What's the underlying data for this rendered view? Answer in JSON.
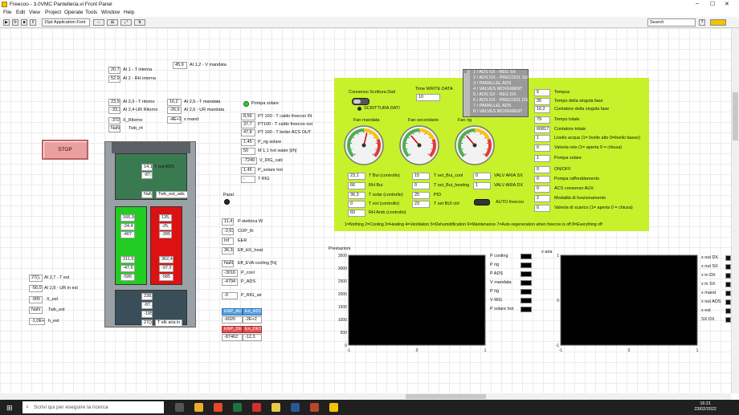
{
  "window": {
    "title": "Freecoo - 3.0VMC Pantelleria.vi Front Panel"
  },
  "menu": [
    "File",
    "Edit",
    "View",
    "Project",
    "Operate",
    "Tools",
    "Window",
    "Help"
  ],
  "toolbar": {
    "font": "15pt Application Font",
    "search_placeholder": "Search"
  },
  "stop_label": "STOP",
  "left_top": [
    {
      "value": "20,7",
      "label": "AI 1 - T interna"
    },
    {
      "value": "52,9",
      "label": "AI 2 - RH interna"
    },
    {
      "value": "45,9",
      "label": "AI 1,2 - V mandata"
    }
  ],
  "left_mid": [
    {
      "value": "23,9",
      "label": "AI 2,3 - T ritorno"
    },
    {
      "value": "-33,3",
      "label": "AI 2,4-UR Ritorno"
    },
    {
      "value": "-372",
      "label": "X_Ritorno"
    },
    {
      "value": "NaN",
      "label": "Twb_rit"
    }
  ],
  "mandata_group": [
    {
      "value": "16,2",
      "label": "AI 2,5 - T mandata"
    },
    {
      "value": "-26,6",
      "label": "AI 2,6 - UR mandata"
    },
    {
      "value": "-4E+2",
      "label": "x mand"
    }
  ],
  "pompa_solare": "Pompa solare",
  "sensors": [
    {
      "value": "8,56",
      "label": "PT 100 - T caldo freecoo IN"
    },
    {
      "value": "37,7",
      "label": "PT100 - T caldo freecoo out"
    },
    {
      "value": "47,8",
      "label": "PT 100 - T boiler ACS OUT"
    },
    {
      "value": "1,45",
      "label": "P_rig solare"
    },
    {
      "value": "50",
      "label": "M 1,1 hot water [l/h]"
    },
    {
      "value": "-7249",
      "label": "V_RIG_calc"
    },
    {
      "value": "1,45",
      "label": "P_solare hot"
    },
    {
      "value": "-",
      "label": "T RIG"
    }
  ],
  "machine_values": {
    "top": [
      "14,1",
      "-87,0"
    ],
    "top_label": "T out ADS",
    "twb_label": "Twb_out_ads",
    "green_upper": [
      "166,9",
      "-24,4",
      "-407"
    ],
    "red_upper": [
      "135,",
      "-25,",
      "-395"
    ],
    "green_lower": [
      "211,9",
      "-47,5",
      "-595"
    ],
    "red_lower": [
      "362,4",
      "-97,5",
      "-585"
    ],
    "bottom": [
      "238,",
      "-87,",
      "-195,"
    ],
    "bottom_label": "T elk aria in"
  },
  "left_bottom": [
    {
      "value": "27(),",
      "label": "AI 2,7 - T est"
    },
    {
      "value": "-56,0",
      "label": "AI 2,8 - UR in est"
    },
    {
      "value": "-905",
      "label": "X_est"
    },
    {
      "value": "NaN",
      "label": "Twb_est"
    },
    {
      "value": "-1,0E+",
      "label": "h_est"
    }
  ],
  "parallel_label": "Paral",
  "perf": [
    {
      "value": "11,4",
      "label": "P elettrica W"
    },
    {
      "value": "-2,63",
      "label": "COP_th"
    },
    {
      "value": "Inf",
      "label": "EER"
    },
    {
      "value": "36,3",
      "label": "Eff_HX_heat"
    },
    {
      "value": "NaN",
      "label": "Eff_EVA cooling [%]"
    },
    {
      "value": "-3016",
      "label": "P_cool"
    },
    {
      "value": "-4794",
      "label": "P_ADS"
    },
    {
      "value": "-0",
      "label": "P_RIG_air"
    }
  ],
  "adsdes": {
    "hdr1": "ENP_ADS",
    "hdr2": "En_ADS",
    "v1": "-6020",
    "v2": "-2E+2",
    "hdr3": "ENP_DES",
    "hdr4": "En_DES",
    "v3": "-87462",
    "v4": "-12,3"
  },
  "lime": {
    "consenso": "Consenso Scrittura Dati",
    "scrittura": "SCRITTURA DATI",
    "time_write_label": "Time WRITE DATA",
    "time_write_value": "10",
    "states": [
      "1 / ADS SX - REG SX",
      "2 / ADS DX - PRECOOL SX",
      "3 / PARALLEL ADS",
      "4 / VALVES MOVEMENT",
      "5 / ADS SX - REG DX",
      "6 / ADS DX - PRECOOL DX",
      "7 / PARALLEL ADS",
      "8 / VALVES MOVEMENT"
    ],
    "states_prefix": "0",
    "fans": [
      "Fan mandata",
      "Fan secondario",
      "Fan rig"
    ],
    "fan_values": [
      0.55,
      0.35,
      0.35
    ],
    "counters": [
      {
        "value": "5",
        "label": "Tempus"
      },
      {
        "value": "35",
        "label": "Tempo della singola fase"
      },
      {
        "value": "16,2",
        "label": "Contatore della singola fase"
      },
      {
        "value": "79",
        "label": "Tempo totale"
      },
      {
        "value": "60817",
        "label": "Contatore totale"
      },
      {
        "value": "1",
        "label": "Livello acqua (1= livello alto 0=livello basso)"
      },
      {
        "value": "0",
        "label": "Valvola rete (1= aperta 0 = chiusa)"
      },
      {
        "value": "1",
        "label": "Pompa solare"
      }
    ],
    "controls": [
      {
        "value": "23,1",
        "label": "T Bui (controllo)"
      },
      {
        "value": "66",
        "label": "RH Bui"
      },
      {
        "value": "36,3",
        "label": "T solar (controllo)"
      },
      {
        "value": "0",
        "label": "T ext (controllo)"
      },
      {
        "value": "60",
        "label": "RH Amb (controllo)"
      }
    ],
    "setpoints": [
      {
        "value": "15",
        "label": "T set_Bui_cool"
      },
      {
        "value": "0",
        "label": "T set_Bui_heating"
      },
      {
        "value": "25",
        "label": "PID"
      },
      {
        "value": "23",
        "label": "T set BUI ctrl"
      }
    ],
    "valves": [
      {
        "value": "0",
        "label": "VALV ARIA SX"
      },
      {
        "value": "1",
        "label": "VALV ARIA DX"
      }
    ],
    "auto_label": "AUTO freecoo",
    "modes": [
      {
        "value": "0",
        "label": "ON/OFF"
      },
      {
        "value": "0",
        "label": "Pompa raffreddamento"
      },
      {
        "value": "0",
        "label": "ACS consenso AUX"
      },
      {
        "value": "2",
        "label": "Modalità di funzionamento"
      },
      {
        "value": "0",
        "label": "Valvola di scarico (1= aperta 0 = chiusa)"
      }
    ],
    "legend": "1=Nothing 2=Cooling 3=Heating 4=Ventilation 5=Dehumidification 6=Maintenance 7=Auto-regeneration when freecoo is off 8=Everything off"
  },
  "graph1": {
    "title": "Prestazioni",
    "yticks": [
      "3500",
      "3000",
      "2500",
      "2000",
      "1500",
      "1000",
      "500",
      "0"
    ],
    "xticks": [
      "-1",
      "0",
      "1"
    ],
    "legend": [
      "P cooling",
      "P rig",
      "P ADS",
      "V mandata",
      "P rig",
      "V RIG",
      "P solare hot"
    ]
  },
  "graph2": {
    "title": "x aria",
    "yticks": [
      "1",
      "0",
      "-1"
    ],
    "xticks": [
      "-1",
      "0",
      "1"
    ],
    "legend": [
      "x out DX",
      "x out SX",
      "x in DX",
      "x in SX",
      "x mand",
      "x out ADS",
      "x est",
      "SX DX"
    ]
  },
  "taskbar": {
    "search": "Scrivi qui per eseguire la ricerca",
    "time": "16:21",
    "date": "23/02/2022"
  },
  "colors": {
    "lime": "#c7f12a",
    "green": "#22cc22",
    "red": "#dd1111"
  }
}
